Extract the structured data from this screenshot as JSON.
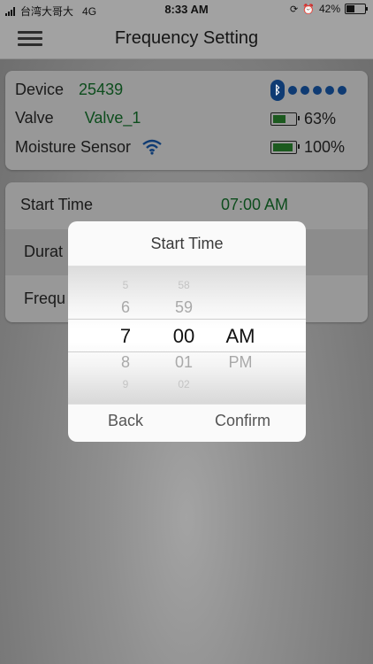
{
  "status_bar": {
    "carrier": "台湾大哥大",
    "network": "4G",
    "time": "8:33 AM",
    "battery": "42%"
  },
  "navbar": {
    "title": "Frequency Setting",
    "menu_icon": "hamburger-icon"
  },
  "info": {
    "device_label": "Device",
    "device_value": "25439",
    "valve_label": "Valve",
    "valve_value": "Valve_1",
    "moisture_label": "Moisture Sensor",
    "valve_battery": "63%",
    "sensor_battery": "100%",
    "valve_battery_level": 0.63,
    "sensor_battery_level": 1.0,
    "signal_dots": 5
  },
  "settings": {
    "start_time_label": "Start Time",
    "start_time_value": "07:00 AM",
    "duration_label": "Durat",
    "frequency_label": "Frequ"
  },
  "picker": {
    "title": "Start Time",
    "hours": [
      "5",
      "6",
      "7",
      "8",
      "9"
    ],
    "minutes": [
      "58",
      "59",
      "00",
      "01",
      "02"
    ],
    "meridiem": [
      "AM",
      "PM"
    ],
    "back_label": "Back",
    "confirm_label": "Confirm"
  },
  "colors": {
    "accent_green": "#0d4d1d",
    "bluetooth_blue": "#0f3b73"
  }
}
